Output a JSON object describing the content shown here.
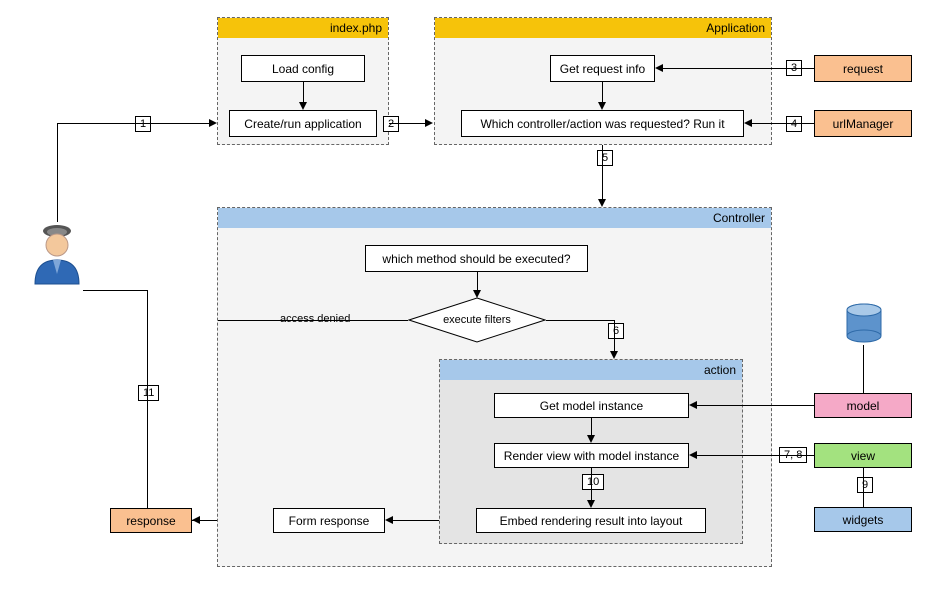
{
  "panels": {
    "index": "index.php",
    "application": "Application",
    "controller": "Controller",
    "action": "action"
  },
  "nodes": {
    "load_config": "Load config",
    "create_run": "Create/run application",
    "get_request": "Get request info",
    "which_ctrl": "Which controller/action was requested? Run it",
    "which_method": "which method should be executed?",
    "exec_filters": "execute filters",
    "get_model": "Get model instance",
    "render_view": "Render view with model instance",
    "embed_layout": "Embed rendering result into layout",
    "form_response": "Form response"
  },
  "labels": {
    "access_denied": "access denied"
  },
  "chips": {
    "request": "request",
    "urlManager": "urlManager",
    "model": "model",
    "view": "view",
    "widgets": "widgets",
    "response": "response"
  },
  "nums": {
    "n1": "1",
    "n2": "2",
    "n3": "3",
    "n4": "4",
    "n5": "5",
    "n6": "6",
    "n7_8": "7, 8",
    "n9": "9",
    "n10": "10",
    "n11": "11"
  }
}
